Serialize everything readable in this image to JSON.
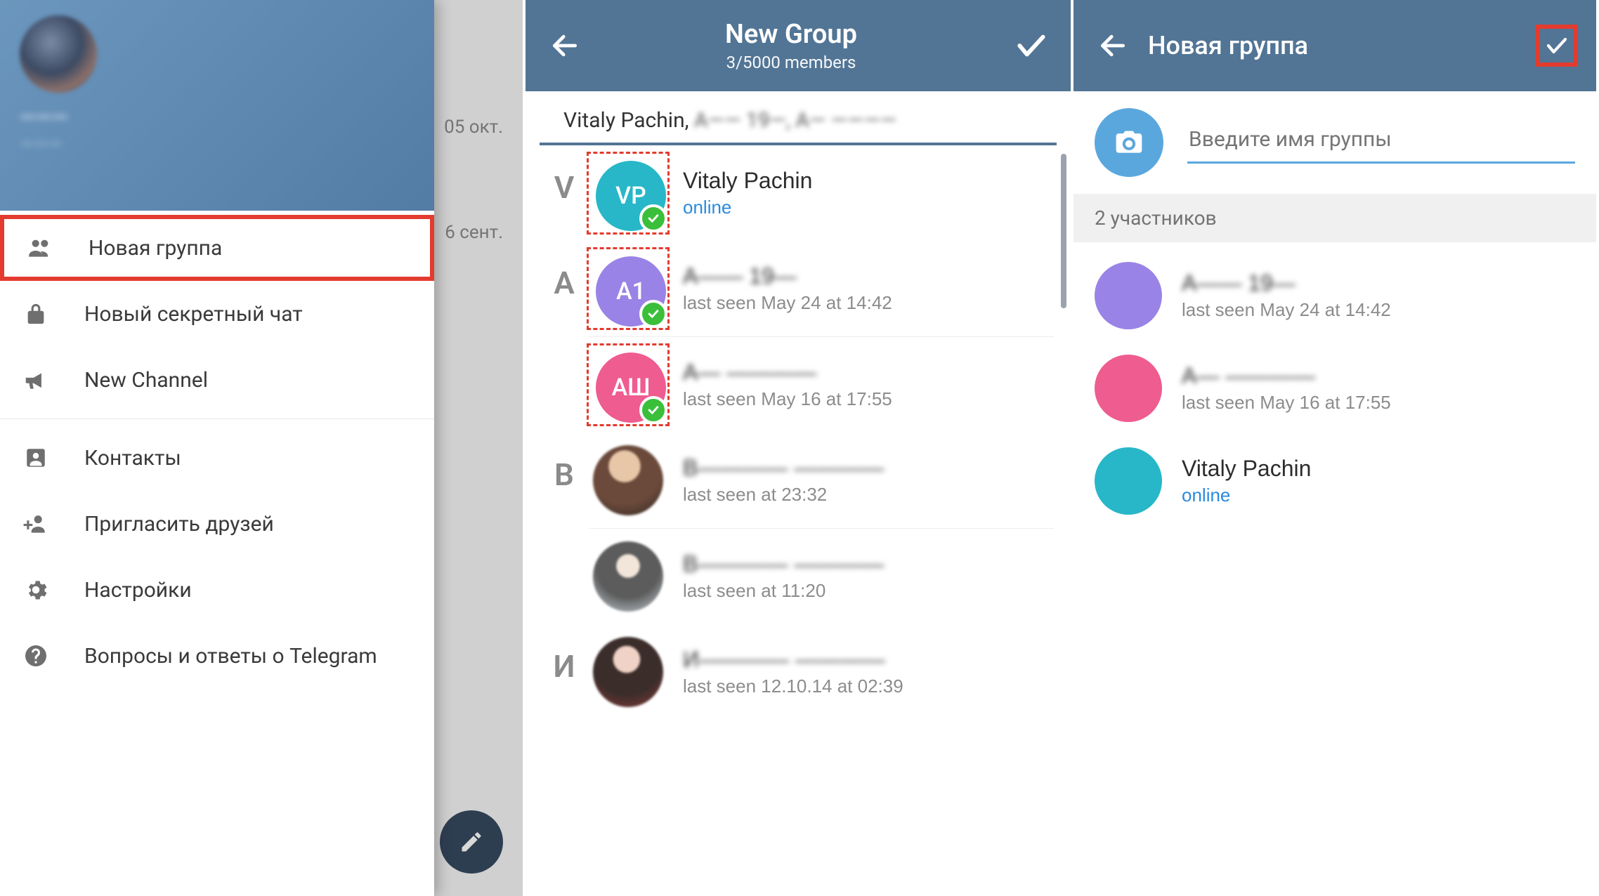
{
  "panel1": {
    "search_icon": "search",
    "bg_dates": [
      "05 окт.",
      "6 сент."
    ],
    "profile_name": "———",
    "profile_phone": "———",
    "menu": [
      {
        "icon": "group",
        "label": "Новая группа",
        "highlight": true
      },
      {
        "icon": "lock",
        "label": "Новый секретный чат"
      },
      {
        "icon": "megaphone",
        "label": "New Channel"
      },
      {
        "sep": true
      },
      {
        "icon": "contact",
        "label": "Контакты"
      },
      {
        "icon": "invite",
        "label": "Пригласить друзей"
      },
      {
        "icon": "gear",
        "label": "Настройки"
      },
      {
        "icon": "help",
        "label": "Вопросы и ответы о Telegram"
      }
    ]
  },
  "panel2": {
    "title": "New Group",
    "subtitle": "3/5000 members",
    "chips_visible": "Vitaly Pachin, ",
    "chips_blurred": "A—— 19—, A— ————",
    "sections": [
      {
        "letter": "V",
        "items": [
          {
            "initials": "VP",
            "color": "#27b7c8",
            "name": "Vitaly Pachin",
            "status": "online",
            "online": true,
            "selected": true
          }
        ]
      },
      {
        "letter": "A",
        "items": [
          {
            "initials": "A1",
            "color": "#9a83e6",
            "name": "A—— 19—",
            "blur": true,
            "status": "last seen May 24 at 14:42",
            "selected": true
          },
          {
            "initials": "АШ",
            "color": "#ef5c8f",
            "name": "A— ————",
            "blur": true,
            "status": "last seen May 16 at 17:55",
            "selected": true
          }
        ]
      },
      {
        "letter": "B",
        "items": [
          {
            "photo": "photo1",
            "name": "B———— ————",
            "blur": true,
            "status": "last seen at 23:32"
          },
          {
            "photo": "photo2",
            "name": "B———— ————",
            "blur": true,
            "status": "last seen at 11:20"
          }
        ]
      },
      {
        "letter": "И",
        "items": [
          {
            "photo": "photo3",
            "name": "И———— ————",
            "blur": true,
            "status": "last seen 12.10.14 at 02:39"
          }
        ]
      }
    ]
  },
  "panel3": {
    "title": "Новая группа",
    "name_placeholder": "Введите имя группы",
    "members_label": "2 участников",
    "participants": [
      {
        "color": "#9a83e6",
        "name": "A—— 19—",
        "blur": true,
        "status": "last seen May 24 at 14:42"
      },
      {
        "color": "#ef5c8f",
        "name": "A— ————",
        "blur": true,
        "status": "last seen May 16 at 17:55"
      },
      {
        "color": "#27b7c8",
        "name": "Vitaly Pachin",
        "status": "online",
        "online": true
      }
    ]
  }
}
